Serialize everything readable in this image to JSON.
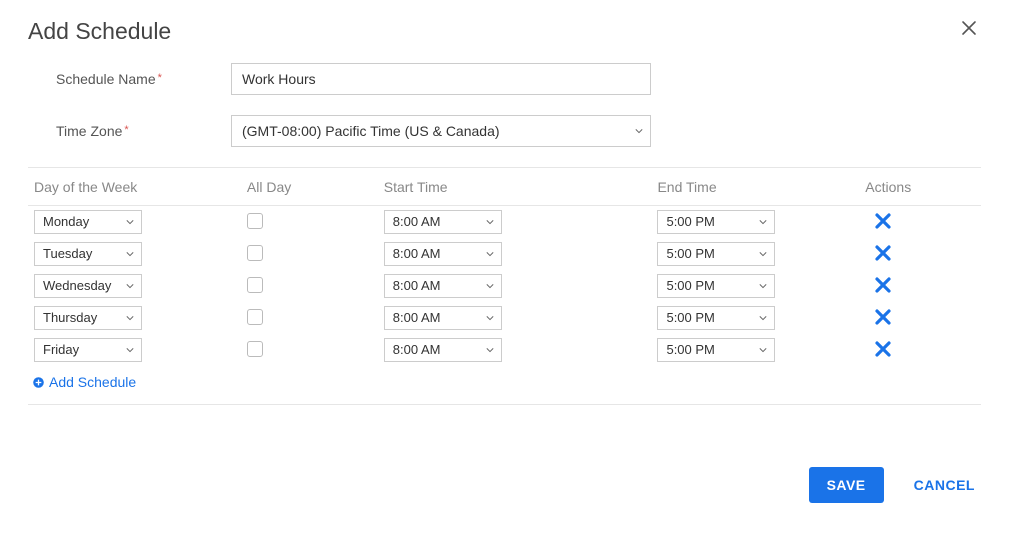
{
  "dialog": {
    "title": "Add Schedule",
    "close_label": "×"
  },
  "form": {
    "schedule_name_label": "Schedule Name",
    "schedule_name_value": "Work Hours",
    "time_zone_label": "Time Zone",
    "time_zone_value": "(GMT-08:00) Pacific Time (US & Canada)"
  },
  "table": {
    "headers": {
      "day": "Day of the Week",
      "all_day": "All Day",
      "start": "Start Time",
      "end": "End Time",
      "actions": "Actions"
    },
    "rows": [
      {
        "day": "Monday",
        "all_day": false,
        "start": "8:00 AM",
        "end": "5:00 PM"
      },
      {
        "day": "Tuesday",
        "all_day": false,
        "start": "8:00 AM",
        "end": "5:00 PM"
      },
      {
        "day": "Wednesday",
        "all_day": false,
        "start": "8:00 AM",
        "end": "5:00 PM"
      },
      {
        "day": "Thursday",
        "all_day": false,
        "start": "8:00 AM",
        "end": "5:00 PM"
      },
      {
        "day": "Friday",
        "all_day": false,
        "start": "8:00 AM",
        "end": "5:00 PM"
      }
    ],
    "add_link": "Add Schedule"
  },
  "buttons": {
    "save": "SAVE",
    "cancel": "CANCEL"
  }
}
